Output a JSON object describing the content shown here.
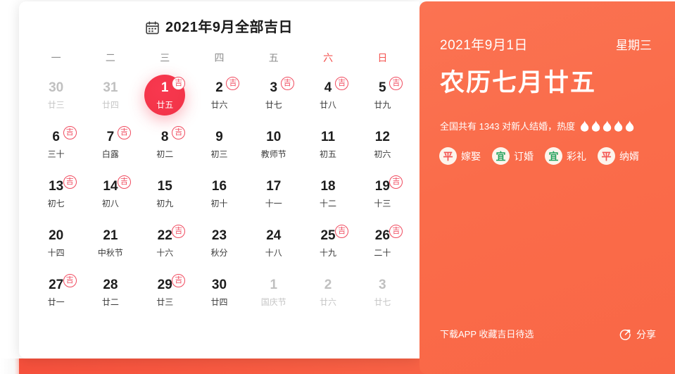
{
  "colors": {
    "panel_orange": "#fa6c4a",
    "selected_red": "#f4354a",
    "lucky_red": "#f04a5e",
    "bottom_bar_red": "#f5503c",
    "tag_good_green": "#23a35d",
    "tag_neutral_red": "#f4524f"
  },
  "card": {
    "icon": "calendar-icon",
    "title": "2021年9月全部吉日",
    "weekdays": [
      {
        "label": "一",
        "weekend": false
      },
      {
        "label": "二",
        "weekend": false
      },
      {
        "label": "三",
        "weekend": false
      },
      {
        "label": "四",
        "weekend": false
      },
      {
        "label": "五",
        "weekend": false
      },
      {
        "label": "六",
        "weekend": true
      },
      {
        "label": "日",
        "weekend": true
      }
    ],
    "lucky_badge_label": "吉",
    "days": [
      {
        "num": "30",
        "lunar": "廿三",
        "lucky": false,
        "muted": true,
        "selected": false
      },
      {
        "num": "31",
        "lunar": "廿四",
        "lucky": false,
        "muted": true,
        "selected": false
      },
      {
        "num": "1",
        "lunar": "廿五",
        "lucky": true,
        "muted": false,
        "selected": true
      },
      {
        "num": "2",
        "lunar": "廿六",
        "lucky": true,
        "muted": false,
        "selected": false
      },
      {
        "num": "3",
        "lunar": "廿七",
        "lucky": true,
        "muted": false,
        "selected": false
      },
      {
        "num": "4",
        "lunar": "廿八",
        "lucky": true,
        "muted": false,
        "selected": false
      },
      {
        "num": "5",
        "lunar": "廿九",
        "lucky": true,
        "muted": false,
        "selected": false
      },
      {
        "num": "6",
        "lunar": "三十",
        "lucky": true,
        "muted": false,
        "selected": false
      },
      {
        "num": "7",
        "lunar": "白露",
        "lucky": true,
        "muted": false,
        "selected": false
      },
      {
        "num": "8",
        "lunar": "初二",
        "lucky": true,
        "muted": false,
        "selected": false
      },
      {
        "num": "9",
        "lunar": "初三",
        "lucky": false,
        "muted": false,
        "selected": false
      },
      {
        "num": "10",
        "lunar": "教师节",
        "lucky": false,
        "muted": false,
        "selected": false
      },
      {
        "num": "11",
        "lunar": "初五",
        "lucky": false,
        "muted": false,
        "selected": false
      },
      {
        "num": "12",
        "lunar": "初六",
        "lucky": false,
        "muted": false,
        "selected": false
      },
      {
        "num": "13",
        "lunar": "初七",
        "lucky": true,
        "muted": false,
        "selected": false
      },
      {
        "num": "14",
        "lunar": "初八",
        "lucky": true,
        "muted": false,
        "selected": false
      },
      {
        "num": "15",
        "lunar": "初九",
        "lucky": false,
        "muted": false,
        "selected": false
      },
      {
        "num": "16",
        "lunar": "初十",
        "lucky": false,
        "muted": false,
        "selected": false
      },
      {
        "num": "17",
        "lunar": "十一",
        "lucky": false,
        "muted": false,
        "selected": false
      },
      {
        "num": "18",
        "lunar": "十二",
        "lucky": false,
        "muted": false,
        "selected": false
      },
      {
        "num": "19",
        "lunar": "十三",
        "lucky": true,
        "muted": false,
        "selected": false
      },
      {
        "num": "20",
        "lunar": "十四",
        "lucky": false,
        "muted": false,
        "selected": false
      },
      {
        "num": "21",
        "lunar": "中秋节",
        "lucky": false,
        "muted": false,
        "selected": false
      },
      {
        "num": "22",
        "lunar": "十六",
        "lucky": true,
        "muted": false,
        "selected": false
      },
      {
        "num": "23",
        "lunar": "秋分",
        "lucky": false,
        "muted": false,
        "selected": false
      },
      {
        "num": "24",
        "lunar": "十八",
        "lucky": false,
        "muted": false,
        "selected": false
      },
      {
        "num": "25",
        "lunar": "十九",
        "lucky": true,
        "muted": false,
        "selected": false
      },
      {
        "num": "26",
        "lunar": "二十",
        "lucky": true,
        "muted": false,
        "selected": false
      },
      {
        "num": "27",
        "lunar": "廿一",
        "lucky": true,
        "muted": false,
        "selected": false
      },
      {
        "num": "28",
        "lunar": "廿二",
        "lucky": false,
        "muted": false,
        "selected": false
      },
      {
        "num": "29",
        "lunar": "廿三",
        "lucky": true,
        "muted": false,
        "selected": false
      },
      {
        "num": "30",
        "lunar": "廿四",
        "lucky": false,
        "muted": false,
        "selected": false
      },
      {
        "num": "1",
        "lunar": "国庆节",
        "lucky": false,
        "muted": true,
        "selected": false
      },
      {
        "num": "2",
        "lunar": "廿六",
        "lucky": false,
        "muted": true,
        "selected": false
      },
      {
        "num": "3",
        "lunar": "廿七",
        "lucky": false,
        "muted": true,
        "selected": false
      }
    ]
  },
  "panel": {
    "date": "2021年9月1日",
    "weekday": "星期三",
    "lunar_date": "农历七月廿五",
    "stat_text": "全国共有 1343 对新人结婚，热度",
    "heat_level": 5,
    "tags": [
      {
        "mark": "平",
        "label": "嫁娶",
        "good": false
      },
      {
        "mark": "宜",
        "label": "订婚",
        "good": true
      },
      {
        "mark": "宜",
        "label": "彩礼",
        "good": true
      },
      {
        "mark": "平",
        "label": "纳婿",
        "good": false
      }
    ],
    "footer_hint": "下载APP 收藏吉日待选",
    "share_icon": "share-icon",
    "share_label": "分享"
  }
}
